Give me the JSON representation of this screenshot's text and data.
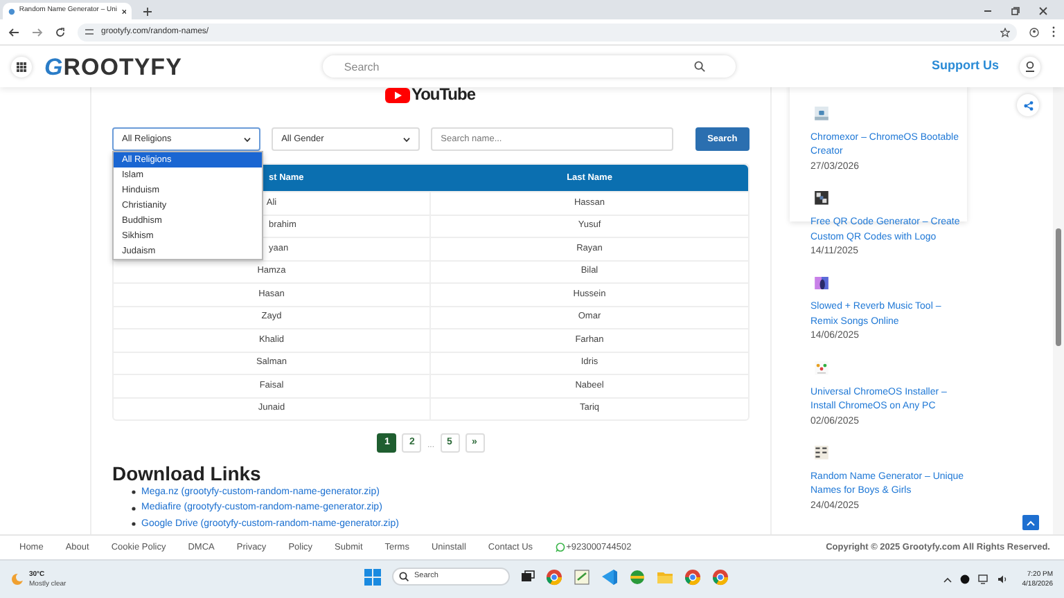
{
  "browser": {
    "tab_title": "Random Name Generator – Uni",
    "url": "grootyfy.com/random-names/"
  },
  "header": {
    "logo_mark": "G",
    "logo_text": "ROOTYFY",
    "search_placeholder": "Search",
    "support_link": "Support Us"
  },
  "youtube_logo": "YouTube",
  "filters": {
    "religion": {
      "value": "All Religions",
      "options": [
        {
          "label": "All Religions",
          "selected": true
        },
        {
          "label": "Islam",
          "selected": false
        },
        {
          "label": "Hinduism",
          "selected": false
        },
        {
          "label": "Christianity",
          "selected": false
        },
        {
          "label": "Buddhism",
          "selected": false
        },
        {
          "label": "Sikhism",
          "selected": false
        },
        {
          "label": "Judaism",
          "selected": false
        }
      ]
    },
    "gender": {
      "value": "All Gender"
    },
    "search": {
      "placeholder": "Search name..."
    },
    "button": "Search"
  },
  "table": {
    "columns": [
      {
        "label": "st Name",
        "hidden_start": true
      },
      {
        "label": "Last Name",
        "hidden_start": false
      }
    ],
    "rows": [
      [
        {
          "text": "Ali",
          "hidden_start": false
        },
        {
          "text": "Hassan",
          "hidden_start": false
        }
      ],
      [
        {
          "text": "brahim",
          "hidden_start": true
        },
        {
          "text": "Yusuf",
          "hidden_start": false
        }
      ],
      [
        {
          "text": "yaan",
          "hidden_start": true
        },
        {
          "text": "Rayan",
          "hidden_start": false
        }
      ],
      [
        {
          "text": "Hamza",
          "hidden_start": false
        },
        {
          "text": "Bilal",
          "hidden_start": false
        }
      ],
      [
        {
          "text": "Hasan",
          "hidden_start": false
        },
        {
          "text": "Hussein",
          "hidden_start": false
        }
      ],
      [
        {
          "text": "Zayd",
          "hidden_start": false
        },
        {
          "text": "Omar",
          "hidden_start": false
        }
      ],
      [
        {
          "text": "Khalid",
          "hidden_start": false
        },
        {
          "text": "Farhan",
          "hidden_start": false
        }
      ],
      [
        {
          "text": "Salman",
          "hidden_start": false
        },
        {
          "text": "Idris",
          "hidden_start": false
        }
      ],
      [
        {
          "text": "Faisal",
          "hidden_start": false
        },
        {
          "text": "Nabeel",
          "hidden_start": false
        }
      ],
      [
        {
          "text": "Junaid",
          "hidden_start": false
        },
        {
          "text": "Tariq",
          "hidden_start": false
        }
      ]
    ]
  },
  "pagination": [
    {
      "kind": "page",
      "label": "1",
      "selected": true
    },
    {
      "kind": "page",
      "label": "2",
      "selected": false
    },
    {
      "kind": "gap",
      "label": "..."
    },
    {
      "kind": "page",
      "label": "5",
      "selected": false
    },
    {
      "kind": "page",
      "label": "»",
      "selected": false
    }
  ],
  "downloads": {
    "heading": "Download Links",
    "links": [
      "Mega.nz (grootyfy-custom-random-name-generator.zip)",
      "Mediafire (grootyfy-custom-random-name-generator.zip)",
      "Google Drive (grootyfy-custom-random-name-generator.zip)"
    ]
  },
  "sidebar": {
    "posts": [
      {
        "title": "Chromexor – ChromeOS Bootable Creator",
        "date": "27/03/2026"
      },
      {
        "title": "Free QR Code Generator – Create Custom QR Codes with Logo",
        "date": "14/11/2025"
      },
      {
        "title": "Slowed + Reverb Music Tool – Remix Songs Online",
        "date": "14/06/2025"
      },
      {
        "title": "Universal ChromeOS Installer – Install ChromeOS on Any PC",
        "date": "02/06/2025"
      },
      {
        "title": "Random Name Generator – Unique Names for Boys & Girls",
        "date": "24/04/2025"
      }
    ]
  },
  "footer": {
    "links": [
      "Home",
      "About",
      "Cookie Policy",
      "DMCA",
      "Privacy",
      "Policy",
      "Submit",
      "Terms",
      "Uninstall",
      "Contact Us"
    ],
    "phone": "+923000744502",
    "copyright": "Copyright © 2025 Grootyfy.com All Rights Reserved."
  },
  "taskbar": {
    "temperature": "30°C",
    "weather": "Mostly clear",
    "search_placeholder": "Search",
    "time": "7:20 PM",
    "date": "4/18/2026"
  }
}
